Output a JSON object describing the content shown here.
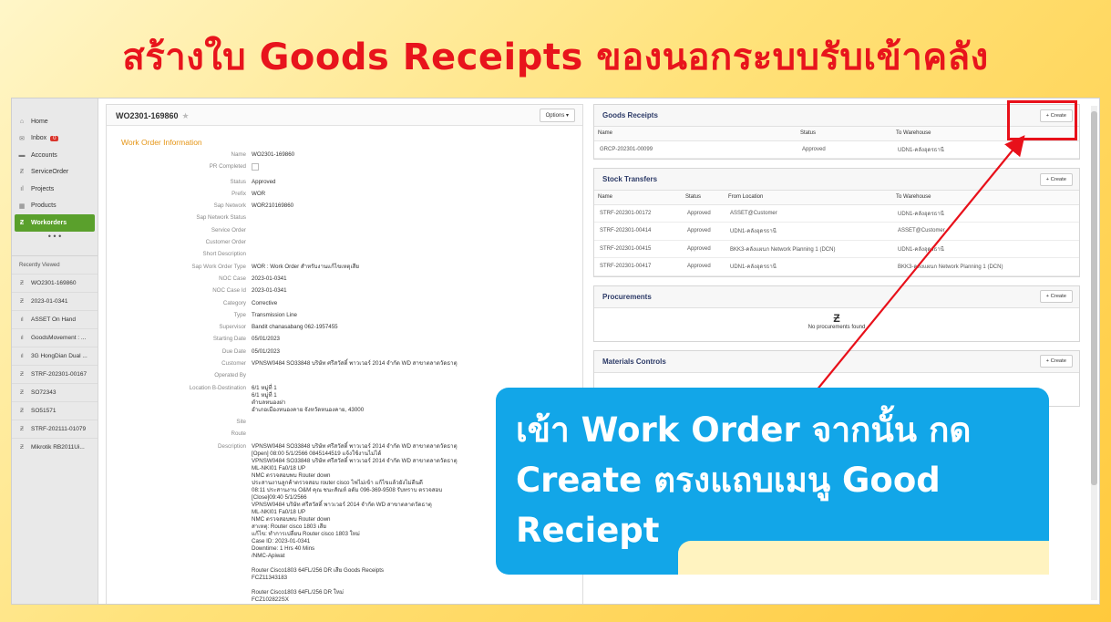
{
  "banner": {
    "title": "สร้างใบ Goods Receipts ของนอกระบบรับเข้าคลัง"
  },
  "sidebar": {
    "nav": [
      {
        "label": "Home",
        "icon": "home-icon",
        "glyph": "⌂"
      },
      {
        "label": "Inbox",
        "icon": "inbox-icon",
        "glyph": "✉",
        "badge": "0"
      },
      {
        "label": "Accounts",
        "icon": "folder-icon",
        "glyph": "▬"
      },
      {
        "label": "ServiceOrder",
        "icon": "service-order-icon",
        "glyph": "Ƶ"
      },
      {
        "label": "Projects",
        "icon": "bar-chart-icon",
        "glyph": "ıl"
      },
      {
        "label": "Products",
        "icon": "products-icon",
        "glyph": "▦"
      },
      {
        "label": "Workorders",
        "icon": "workorders-icon",
        "glyph": "Ƶ",
        "active": true
      }
    ],
    "more": "• • •",
    "recent_title": "Recently Viewed",
    "recent": [
      {
        "label": "WO2301-169860",
        "glyph": "Ƶ"
      },
      {
        "label": "2023-01-0341",
        "glyph": "Ƶ"
      },
      {
        "label": "ASSET On Hand",
        "glyph": "ıl"
      },
      {
        "label": "GoodsMovement : ...",
        "glyph": "ıl"
      },
      {
        "label": "3G HongDian Dual ...",
        "glyph": "ıl"
      },
      {
        "label": "STRF-202301-00167",
        "glyph": "Ƶ"
      },
      {
        "label": "SO72343",
        "glyph": "Ƶ"
      },
      {
        "label": "SO51571",
        "glyph": "Ƶ"
      },
      {
        "label": "STRF-202111-01079",
        "glyph": "Ƶ"
      },
      {
        "label": "Mikrotik RB2011Ui...",
        "glyph": "Ƶ"
      }
    ]
  },
  "work_order": {
    "title": "WO2301-169860",
    "options_label": "Options ▾",
    "section_title": "Work Order Information",
    "fields": [
      {
        "label": "Name",
        "value": "WO2301-169860"
      },
      {
        "label": "PR Completed",
        "value": "",
        "checkbox": true
      },
      {
        "label": "Status",
        "value": "Approved"
      },
      {
        "label": "Prefix",
        "value": "WOR"
      },
      {
        "label": "Sap Network",
        "value": "WOR210169860"
      },
      {
        "label": "Sap Network Status",
        "value": ""
      },
      {
        "label": "Service Order",
        "value": ""
      },
      {
        "label": "Customer Order",
        "value": ""
      },
      {
        "label": "Short Description",
        "value": ""
      },
      {
        "label": "Sap Work Order Type",
        "value": "WOR : Work Order สำหรับงานแก้ไขเหตุเสีย"
      },
      {
        "label": "NOC Case",
        "value": "2023-01-0341"
      },
      {
        "label": "NOC Case Id",
        "value": "2023-01-0341"
      },
      {
        "label": "Category",
        "value": "Corrective"
      },
      {
        "label": "Type",
        "value": "Transmission Line"
      },
      {
        "label": "Supervisor",
        "value": "Bandit chanasabang 062-1957455"
      },
      {
        "label": "Starting Date",
        "value": "05/01/2023"
      },
      {
        "label": "Due Date",
        "value": "05/01/2023"
      },
      {
        "label": "Customer",
        "value": "VPNSW0484 SO33848 บริษัท ศรีสวัสดิ์ พาวเวอร์ 2014 จำกัด WD สาขาตลาดวัดธาตุ"
      },
      {
        "label": "Operated By",
        "value": ""
      },
      {
        "label": "Location B-Destination",
        "value": "6/1 หมู่ที่ 1\n6/1 หมู่ที่ 1\nตำบลหนองฝา\nอำเภอเมืองหนองคาย จังหวัดหนองคาย, 43000"
      },
      {
        "label": "Site",
        "value": ""
      },
      {
        "label": "Route",
        "value": ""
      },
      {
        "label": "Description",
        "value": "VPNSW0484 SO33848 บริษัท ศรีสวัสดิ์ พาวเวอร์ 2014 จำกัด WD สาขาตลาดวัดธาตุ\n[Open] 08:00 5/1/2566 0845144519 แจ้งใช้งานไม่ได้\nVPNSW0484 SO33848 บริษัท ศรีสวัสดิ์ พาวเวอร์ 2014 จำกัด WD สาขาตลาดวัดธาตุ\nML-NKI01 Fa0/18 UP\nNMC ตรวจสอบพบ Router down\nประสานงานลูกค้าตรวจสอบ router cisco ไฟไม่เข้า แก้ไขแล้วยังไม่ดีนดี\n08:11 ประสานงาน O&M คุณ ชนะสัณห์ อดัม 096-369-9508 รับทราบ ตรวจสอบ\n[Close]09:40 5/1/2566\nVPNSW0484 บริษัท ศรีสวัสดิ์ พาวเวอร์ 2014 จำกัด WD สาขาตลาดวัดธาตุ\nML-NKI01 Fa0/18 UP\nNMC ตรวจสอบพบ Router down\nสาเหตุ: Router cisco 1803 เสีย\nแก้ไข: ทำการเปลี่ยน Router cisco 1803 ใหม่\nCase ID: 2023-01-0341\nDowntime: 1 Hrs 40 Mins\n/NMC-Apiwat\n\nRouter Cisco1803 64FL/256 DR เสีย Goods Receipts\nFCZ11343183\n\nRouter Cisco1803 64FL/256 DR ใหม่\nFCZ102822SX"
      }
    ]
  },
  "panels": {
    "goods_receipts": {
      "title": "Goods Receipts",
      "create_label": "+ Create",
      "columns": [
        "Name",
        "Status",
        "To Warehouse"
      ],
      "rows": [
        [
          "GRCP-202301-00099",
          "Approved",
          "UDN1-คลังอุดรธานี"
        ]
      ]
    },
    "stock_transfers": {
      "title": "Stock Transfers",
      "create_label": "+ Create",
      "columns": [
        "Name",
        "Status",
        "From Location",
        "To Warehouse"
      ],
      "rows": [
        [
          "STRF-202301-00172",
          "Approved",
          "ASSET@Customer",
          "UDN1-คลังอุดรธานี"
        ],
        [
          "STRF-202301-00414",
          "Approved",
          "UDN1-คลังอุดรธานี",
          "ASSET@Customer"
        ],
        [
          "STRF-202301-00415",
          "Approved",
          "BKK3-คลังแผนก Network Planning 1 (DCN)",
          "UDN1-คลังอุดรธานี"
        ],
        [
          "STRF-202301-00417",
          "Approved",
          "UDN1-คลังอุดรธานี",
          "BKK3-คลังแผนก Network Planning 1 (DCN)"
        ]
      ]
    },
    "procurements": {
      "title": "Procurements",
      "create_label": "+ Create",
      "empty_glyph": "Ƶ",
      "empty_text": "No procurements found"
    },
    "materials_controls": {
      "title": "Materials Controls",
      "create_label": "+ Create"
    }
  },
  "callout": {
    "line1": "เข้า Work Order จากนั้น กด",
    "line2": "Create ตรงแถบเมนู Good",
    "line3": "Reciept"
  },
  "colors": {
    "accent_red": "#e8141c",
    "callout_blue": "#12a6e8",
    "active_green": "#5aa02c",
    "section_orange": "#e59516"
  }
}
